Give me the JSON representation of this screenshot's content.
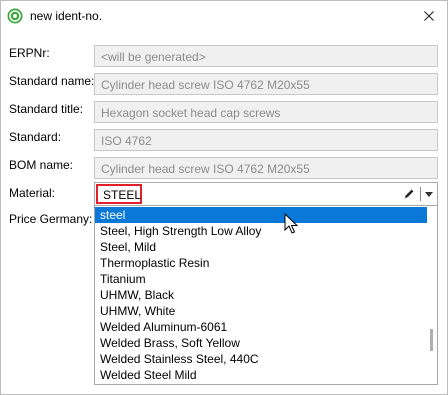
{
  "window": {
    "title": "new ident-no."
  },
  "form": {
    "fields": [
      {
        "label": "ERPNr:",
        "value": "<will be generated>"
      },
      {
        "label": "Standard name:",
        "value": "Cylinder head screw ISO 4762 M20x55"
      },
      {
        "label": "Standard title:",
        "value": "Hexagon socket head cap screws"
      },
      {
        "label": "Standard:",
        "value": "ISO 4762"
      },
      {
        "label": "BOM name:",
        "value": "Cylinder head screw ISO 4762 M20x55"
      }
    ],
    "material": {
      "label": "Material:",
      "value": "STEEL"
    },
    "price": {
      "label": "Price Germany:"
    }
  },
  "dropdown": {
    "selected_index": 0,
    "options": [
      "steel",
      "Steel, High Strength Low Alloy",
      "Steel, Mild",
      "Thermoplastic Resin",
      "Titanium",
      "UHMW, Black",
      "UHMW, White",
      "Welded Aluminum-6061",
      "Welded Brass, Soft Yellow",
      "Welded Stainless Steel, 440C",
      "Welded Steel Mild"
    ]
  },
  "colors": {
    "selection": "#0a78d7",
    "highlight_border": "#e0202a",
    "app_icon": "#3aa63a"
  },
  "icons": {
    "app": "app-logo-icon",
    "close": "close-icon",
    "edit": "pencil-icon",
    "dropdown": "chevron-down-icon"
  }
}
